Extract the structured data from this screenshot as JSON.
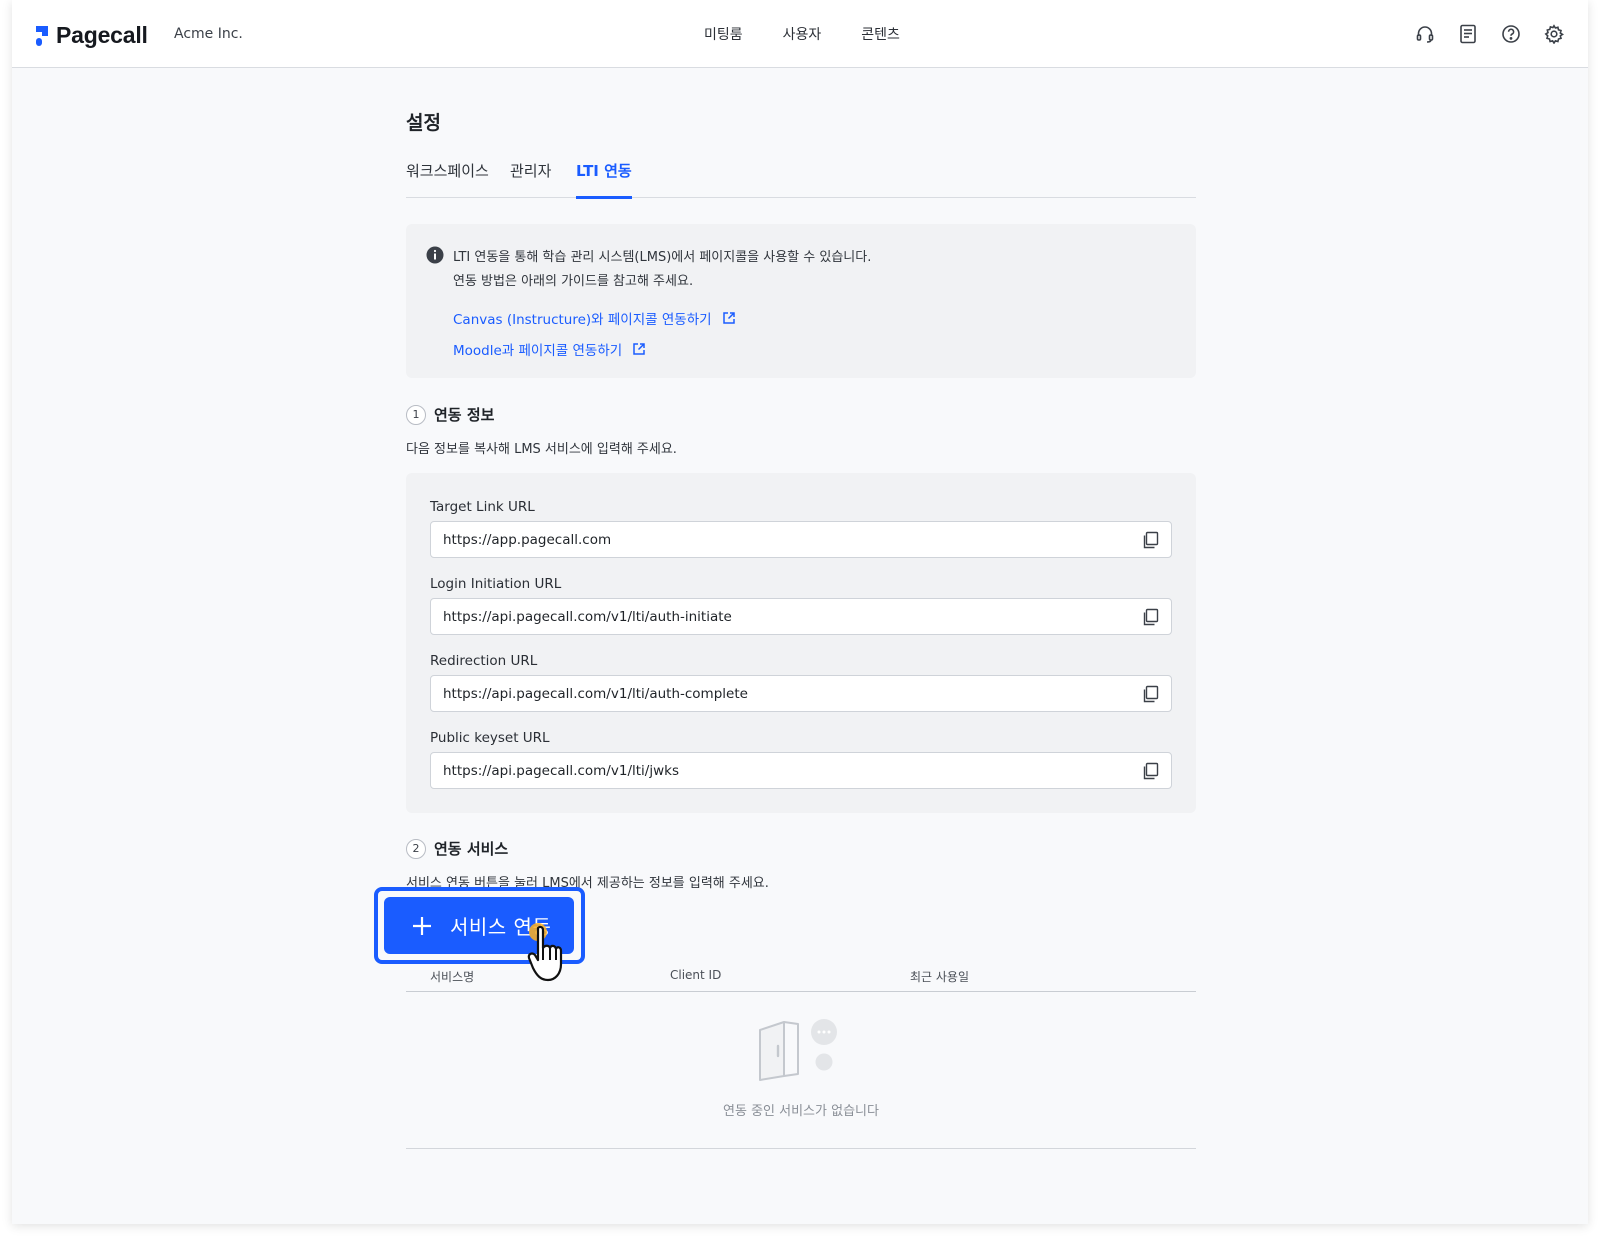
{
  "app": {
    "brand": "Pagecall",
    "org": "Acme Inc.",
    "accent": "#1a5cff"
  },
  "nav": [
    {
      "label": "미팅룸"
    },
    {
      "label": "사용자"
    },
    {
      "label": "콘텐츠"
    }
  ],
  "top_icons": [
    "headset-icon",
    "document-icon",
    "help-icon",
    "gear-icon"
  ],
  "page": {
    "title": "설정",
    "tabs": [
      {
        "label": "워크스페이스",
        "active": false
      },
      {
        "label": "관리자",
        "active": false
      },
      {
        "label": "LTI 연동",
        "active": true
      }
    ]
  },
  "info": {
    "line1": "LTI 연동을 통해 학습 관리 시스템(LMS)에서 페이지콜을 사용할 수 있습니다.",
    "line2": "연동 방법은 아래의 가이드를 참고해 주세요.",
    "links": [
      {
        "label": "Canvas (Instructure)와 페이지콜 연동하기"
      },
      {
        "label": "Moodle과 페이지콜 연동하기"
      }
    ]
  },
  "section1": {
    "step": "1",
    "title": "연동 정보",
    "desc": "다음 정보를 복사해 LMS 서비스에 입력해 주세요.",
    "fields": [
      {
        "label": "Target Link URL",
        "value": "https://app.pagecall.com"
      },
      {
        "label": "Login Initiation URL",
        "value": "https://api.pagecall.com/v1/lti/auth-initiate"
      },
      {
        "label": "Redirection URL",
        "value": "https://api.pagecall.com/v1/lti/auth-complete"
      },
      {
        "label": "Public keyset URL",
        "value": "https://api.pagecall.com/v1/lti/jwks"
      }
    ]
  },
  "section2": {
    "step": "2",
    "title": "연동 서비스",
    "desc": "서비스 연동 버튼을 눌러 LMS에서 제공하는 정보를 입력해 주세요.",
    "add_button": "서비스 연동",
    "columns": [
      "서비스명",
      "Client ID",
      "최근 사용일"
    ],
    "empty_text": "연동 중인 서비스가 없습니다"
  }
}
